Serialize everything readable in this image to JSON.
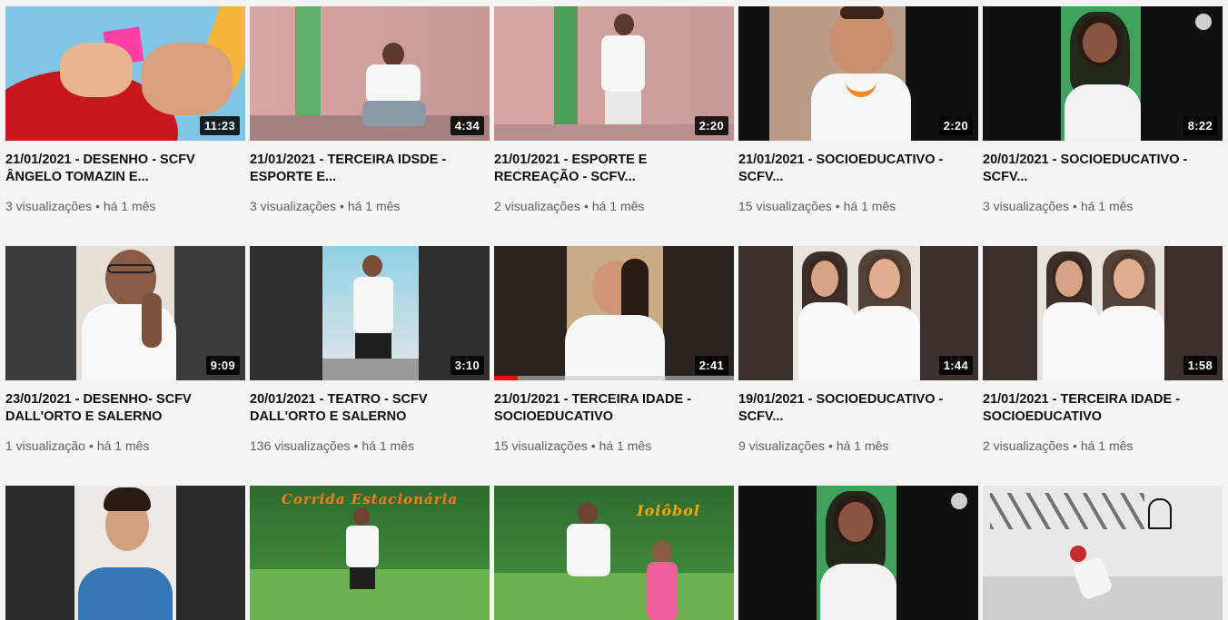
{
  "videos": [
    {
      "title": "21/01/2021 - DESENHO - SCFV ÂNGELO TOMAZIN E...",
      "duration": "11:23",
      "views": "3 visualizações",
      "age": "há 1 mês",
      "scene": "desenho"
    },
    {
      "title": "21/01/2021 - TERCEIRA IDSDE - ESPORTE E...",
      "duration": "4:34",
      "views": "3 visualizações",
      "age": "há 1 mês",
      "scene": "seated-man"
    },
    {
      "title": "21/01/2021 - ESPORTE E RECREAÇÃO - SCFV...",
      "duration": "2:20",
      "views": "2 visualizações",
      "age": "há 1 mês",
      "scene": "standing-man"
    },
    {
      "title": "21/01/2021 - SOCIOEDUCATIVO - SCFV...",
      "duration": "2:20",
      "views": "15 visualizações",
      "age": "há 1 mês",
      "scene": "woman-vertical"
    },
    {
      "title": "20/01/2021 - SOCIOEDUCATIVO - SCFV...",
      "duration": "8:22",
      "views": "3 visualizações",
      "age": "há 1 mês",
      "scene": "woman-phone"
    },
    {
      "title": "23/01/2021 - DESENHO- SCFV DALL'ORTO E SALERNO",
      "duration": "9:09",
      "views": "1 visualização",
      "age": "há 1 mês",
      "scene": "man-glasses"
    },
    {
      "title": "20/01/2021 - TEATRO - SCFV DALL'ORTO E SALERNO",
      "duration": "3:10",
      "views": "136 visualizações",
      "age": "há 1 mês",
      "scene": "teatro"
    },
    {
      "title": "21/01/2021 - TERCEIRA IDADE - SOCIOEDUCATIVO",
      "duration": "2:41",
      "views": "15 visualizações",
      "age": "há 1 mês",
      "scene": "woman-hair",
      "progress": 0.1
    },
    {
      "title": "19/01/2021 - SOCIOEDUCATIVO - SCFV...",
      "duration": "1:44",
      "views": "9 visualizações",
      "age": "há 1 mês",
      "scene": "two-women"
    },
    {
      "title": "21/01/2021 - TERCEIRA IDADE - SOCIOEDUCATIVO",
      "duration": "1:58",
      "views": "2 visualizações",
      "age": "há 1 mês",
      "scene": "two-women"
    },
    {
      "title": "",
      "duration": "",
      "views": "",
      "age": "",
      "scene": "young-woman"
    },
    {
      "title": "",
      "duration": "",
      "views": "",
      "age": "",
      "scene": "corrida",
      "overlay": "Corrida Estacionária"
    },
    {
      "title": "",
      "duration": "",
      "views": "",
      "age": "",
      "scene": "ioiobol",
      "overlay": "Ioiôbol"
    },
    {
      "title": "",
      "duration": "",
      "views": "",
      "age": "",
      "scene": "woman-phone"
    },
    {
      "title": "",
      "duration": "",
      "views": "",
      "age": "",
      "scene": "birds"
    }
  ],
  "meta_separator": "•",
  "colors": {
    "background": "#f4f4f4",
    "title": "#0f0f0f",
    "meta": "#606060",
    "progress": "#ff0000"
  }
}
